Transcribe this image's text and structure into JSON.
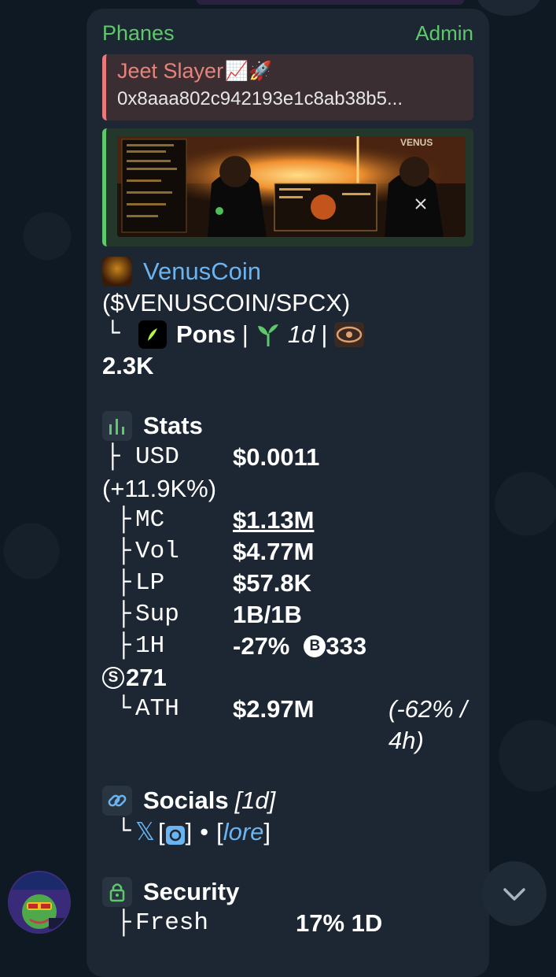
{
  "message": {
    "sender": "Phanes",
    "badge": "Admin",
    "reply": {
      "title": "Jeet Slayer",
      "title_emojis": "📈🚀",
      "text": "0x8aaa802c942193e1c8ab38b5..."
    },
    "token": {
      "name": "VenusCoin",
      "pair": "($VENUSCOIN/SPCX)",
      "platform": "Pons",
      "age": "1d",
      "views": "2.3K",
      "sep": "|"
    },
    "stats": {
      "heading": "Stats",
      "rows": [
        {
          "label": "USD",
          "value": "$0.0011",
          "extra": "(+11.9K%)"
        },
        {
          "label": "MC",
          "value": "$1.13M"
        },
        {
          "label": "Vol",
          "value": "$4.77M"
        },
        {
          "label": "LP",
          "value": "$57.8K"
        },
        {
          "label": "Sup",
          "value": "1B/1B"
        },
        {
          "label": "1H",
          "value": "-27%",
          "buys": "333",
          "sells": "271"
        },
        {
          "label": "ATH",
          "value": "$2.97M",
          "extra": "(-62% / 4h)"
        }
      ]
    },
    "socials": {
      "heading": "Socials",
      "age": "[1d]",
      "x_label": "𝕏",
      "lore": "lore"
    },
    "security": {
      "heading": "Security",
      "partial": "Fresh",
      "partial_value": "17%  1D"
    }
  },
  "colors": {
    "background": "#0f1923",
    "bubble": "#1c2733",
    "sender": "#5ec86a",
    "reply_accent": "#e87a7a",
    "link": "#6cb4f0"
  }
}
